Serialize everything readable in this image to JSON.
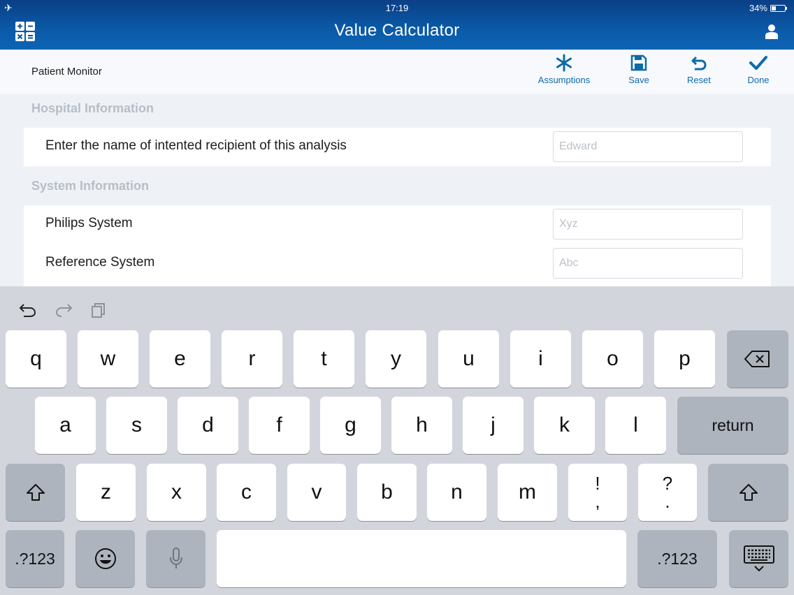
{
  "status_bar": {
    "time": "17:19",
    "battery": "34%",
    "battery_level": 0.34
  },
  "nav": {
    "title": "Value Calculator",
    "left_icon": "calculator-icon",
    "right_icon": "user-icon"
  },
  "toolbar": {
    "page_label": "Patient Monitor",
    "actions": [
      {
        "label": "Assumptions",
        "icon": "asterisk-icon"
      },
      {
        "label": "Save",
        "icon": "floppy-disk-icon"
      },
      {
        "label": "Reset",
        "icon": "undo-arrow-icon"
      },
      {
        "label": "Done",
        "icon": "checkmark-icon"
      }
    ]
  },
  "sections": {
    "hospital": {
      "heading": "Hospital Information",
      "rows": [
        {
          "label": "Enter the name of intented recipient of this analysis",
          "placeholder": "Edward"
        }
      ]
    },
    "system": {
      "heading": "System Information",
      "rows": [
        {
          "label": "Philips System",
          "placeholder": "Xyz"
        },
        {
          "label": "Reference System",
          "placeholder": "Abc"
        }
      ]
    }
  },
  "keyboard": {
    "row1": [
      "q",
      "w",
      "e",
      "r",
      "t",
      "y",
      "u",
      "i",
      "o",
      "p"
    ],
    "row2": [
      "a",
      "s",
      "d",
      "f",
      "g",
      "h",
      "j",
      "k",
      "l"
    ],
    "return_label": "return",
    "row3": [
      "z",
      "x",
      "c",
      "v",
      "b",
      "n",
      "m"
    ],
    "punct1": [
      "!",
      ","
    ],
    "punct2": [
      "?",
      "."
    ],
    "numbers_label": ".?123"
  },
  "colors": {
    "header": "#0b5aa8",
    "accent": "#0d6aa8",
    "keyboard_bg": "#d2d6dc"
  }
}
